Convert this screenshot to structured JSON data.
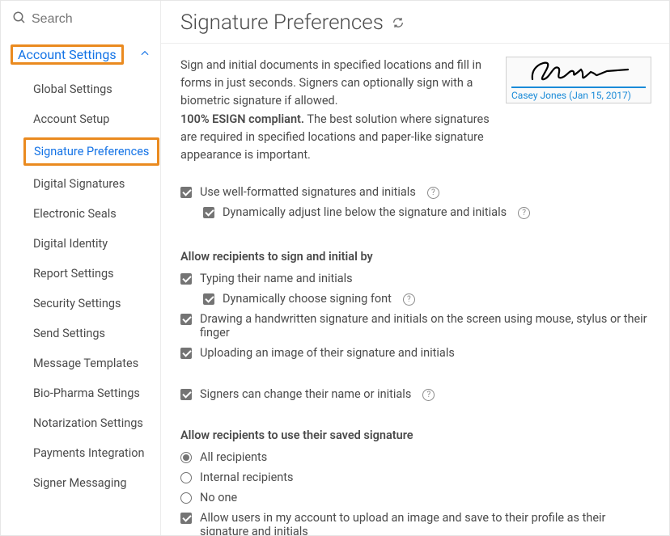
{
  "search": {
    "placeholder": "Search"
  },
  "sidebar": {
    "section": "Account Settings",
    "items": [
      {
        "label": "Global Settings"
      },
      {
        "label": "Account Setup"
      },
      {
        "label": "Signature Preferences",
        "active": true,
        "highlight": true
      },
      {
        "label": "Digital Signatures"
      },
      {
        "label": "Electronic Seals"
      },
      {
        "label": "Digital Identity"
      },
      {
        "label": "Report Settings"
      },
      {
        "label": "Security Settings"
      },
      {
        "label": "Send Settings"
      },
      {
        "label": "Message Templates"
      },
      {
        "label": "Bio-Pharma Settings"
      },
      {
        "label": "Notarization Settings"
      },
      {
        "label": "Payments Integration"
      },
      {
        "label": "Signer Messaging"
      }
    ]
  },
  "page": {
    "title": "Signature Preferences",
    "intro": "Sign and initial documents in specified locations and fill in forms in just seconds. Signers can optionally sign with a biometric signature if allowed.",
    "esign_bold": "100% ESIGN compliant.",
    "esign_rest": " The best solution where signatures are required in specified locations and paper-like signature appearance is important.",
    "signature_name": "Casey Jones (Jan 15, 2017)"
  },
  "general": {
    "formatted": "Use well-formatted signatures and initials",
    "dynamic_line": "Dynamically adjust line below the signature and initials"
  },
  "signby": {
    "heading": "Allow recipients to sign and initial by",
    "typing": "Typing their name and initials",
    "dyn_font": "Dynamically choose signing font",
    "drawing": "Drawing a handwritten signature and initials on the screen using mouse, stylus or their finger",
    "uploading": "Uploading an image of their signature and initials",
    "changename": "Signers can change their name or initials"
  },
  "saved": {
    "heading": "Allow recipients to use their saved signature",
    "all": "All recipients",
    "internal": "Internal recipients",
    "noone": "No one",
    "allowupload": "Allow users in my account to upload an image and save to their profile as their signature and initials"
  }
}
